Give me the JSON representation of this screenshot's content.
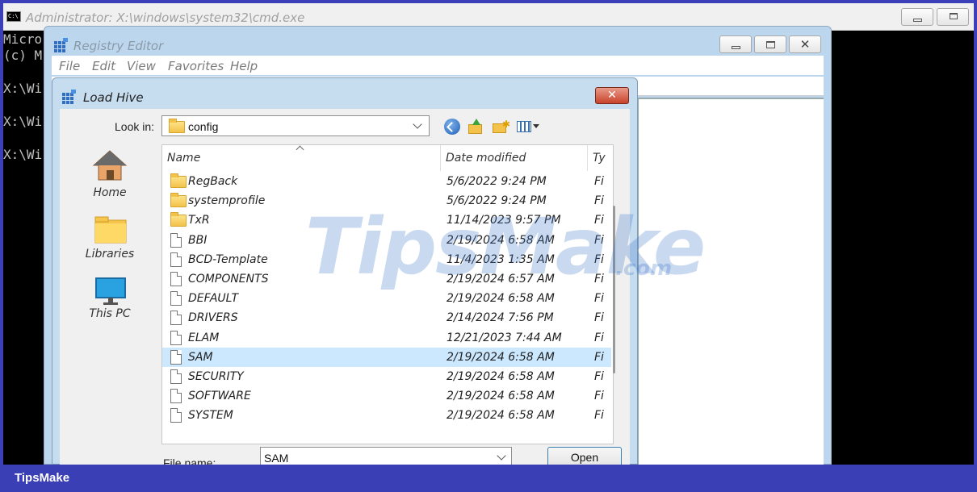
{
  "cmd": {
    "title": "Administrator: X:\\windows\\system32\\cmd.exe",
    "lines": [
      "Micro",
      "(c) M",
      "",
      "X:\\Wi",
      "",
      "X:\\Wi",
      "",
      "X:\\Wi"
    ]
  },
  "regedit": {
    "title": "Registry Editor",
    "menu": [
      "File",
      "Edit",
      "View",
      "Favorites",
      "Help"
    ]
  },
  "dialog": {
    "title": "Load Hive",
    "close_label": "✕",
    "look_in_label": "Look in:",
    "look_in_value": "config",
    "places": [
      {
        "label": "Home",
        "icon": "home-icon"
      },
      {
        "label": "Libraries",
        "icon": "libraries-icon"
      },
      {
        "label": "This PC",
        "icon": "this-pc-icon"
      }
    ],
    "columns": {
      "name": "Name",
      "date": "Date modified",
      "type": "Ty"
    },
    "files": [
      {
        "name": "RegBack",
        "date": "5/6/2022 9:24 PM",
        "type": "Fi",
        "kind": "folder"
      },
      {
        "name": "systemprofile",
        "date": "5/6/2022 9:24 PM",
        "type": "Fi",
        "kind": "folder"
      },
      {
        "name": "TxR",
        "date": "11/14/2023 9:57 PM",
        "type": "Fi",
        "kind": "folder"
      },
      {
        "name": "BBI",
        "date": "2/19/2024 6:58 AM",
        "type": "Fi",
        "kind": "file"
      },
      {
        "name": "BCD-Template",
        "date": "11/4/2023 1:35 AM",
        "type": "Fi",
        "kind": "file"
      },
      {
        "name": "COMPONENTS",
        "date": "2/19/2024 6:57 AM",
        "type": "Fi",
        "kind": "file"
      },
      {
        "name": "DEFAULT",
        "date": "2/19/2024 6:58 AM",
        "type": "Fi",
        "kind": "file"
      },
      {
        "name": "DRIVERS",
        "date": "2/14/2024 7:56 PM",
        "type": "Fi",
        "kind": "file"
      },
      {
        "name": "ELAM",
        "date": "12/21/2023 7:44 AM",
        "type": "Fi",
        "kind": "file"
      },
      {
        "name": "SAM",
        "date": "2/19/2024 6:58 AM",
        "type": "Fi",
        "kind": "file",
        "selected": true
      },
      {
        "name": "SECURITY",
        "date": "2/19/2024 6:58 AM",
        "type": "Fi",
        "kind": "file"
      },
      {
        "name": "SOFTWARE",
        "date": "2/19/2024 6:58 AM",
        "type": "Fi",
        "kind": "file"
      },
      {
        "name": "SYSTEM",
        "date": "2/19/2024 6:58 AM",
        "type": "Fi",
        "kind": "file"
      }
    ],
    "file_name_label": "File name:",
    "file_name_value": "SAM",
    "open_label": "Open"
  },
  "watermark": {
    "main": "TipsMake",
    "suffix": ".com"
  },
  "brand": "TipsMake",
  "colors": {
    "selection": "#cce8ff",
    "close": "#c9432b",
    "accent": "#3a3fb5"
  }
}
